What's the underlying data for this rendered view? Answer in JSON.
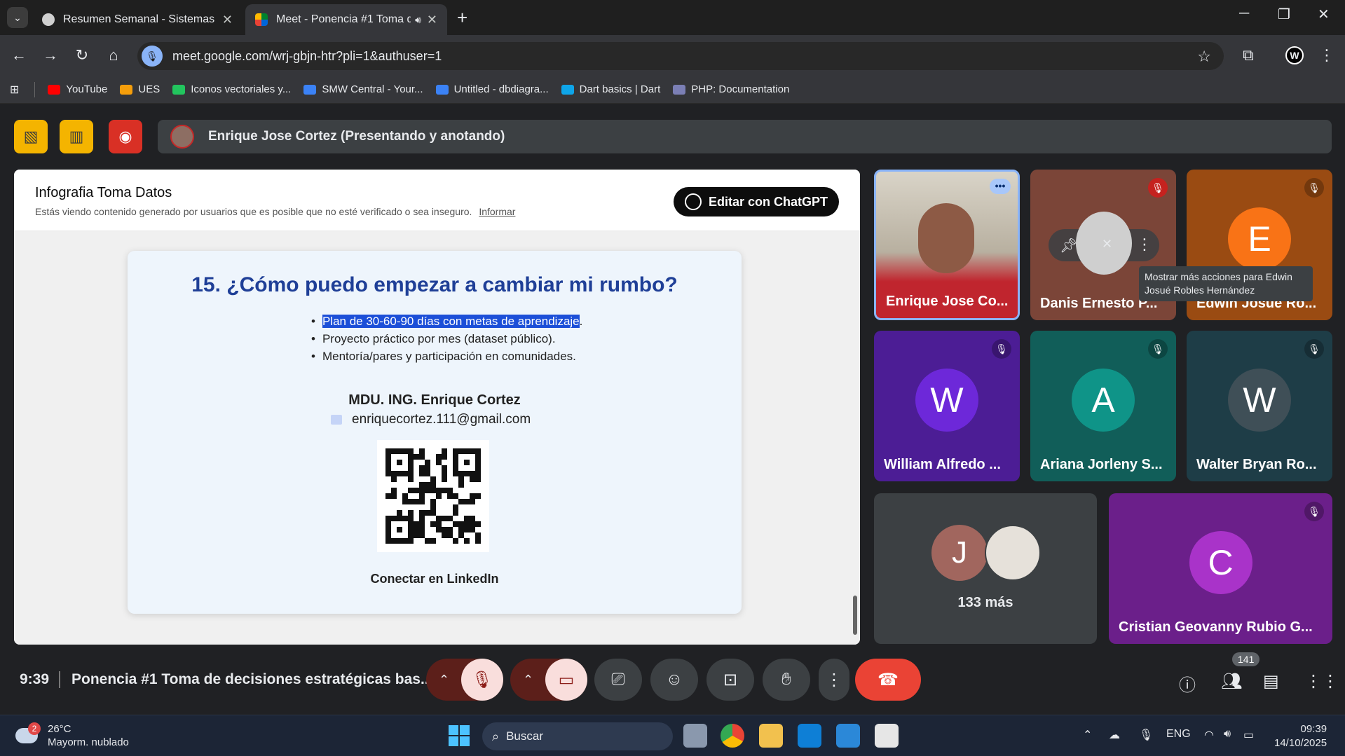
{
  "browser": {
    "tabs": [
      {
        "title": "Resumen Semanal - Sistemas",
        "active": false
      },
      {
        "title": "Meet - Ponencia #1 Toma d",
        "active": true
      }
    ],
    "url": "meet.google.com/wrj-gbjn-htr?pli=1&authuser=1",
    "bookmarks": [
      {
        "label": "YouTube",
        "color": "#ff0000"
      },
      {
        "label": "UES",
        "color": "#f59e0b"
      },
      {
        "label": "Iconos vectoriales y...",
        "color": "#22c55e"
      },
      {
        "label": "SMW Central - Your...",
        "color": "#3b82f6"
      },
      {
        "label": "Untitled - dbdiagra...",
        "color": "#3b82f6"
      },
      {
        "label": "Dart basics | Dart",
        "color": "#0ea5e9"
      },
      {
        "label": "PHP: Documentation",
        "color": "#7b7fb5"
      }
    ]
  },
  "presenter": {
    "text": "Enrique Jose Cortez (Presentando y anotando)"
  },
  "shared_content": {
    "title": "Infografia Toma Datos",
    "warning": "Estás viendo contenido generado por usuarios que es posible que no esté verificado o sea inseguro.",
    "report_link": "Informar",
    "edit_button": "Editar con ChatGPT",
    "slide": {
      "heading": "15. ¿Cómo puedo empezar a cambiar mi rumbo?",
      "bullets": [
        {
          "text": "Plan de 30-60-90 días con metas de aprendizaje",
          "suffix": "."
        },
        {
          "text": "Proyecto práctico por mes (dataset público).",
          "suffix": ""
        },
        {
          "text": "Mentoría/pares y participación en comunidades.",
          "suffix": ""
        }
      ],
      "name": "MDU. ING. Enrique Cortez",
      "email": "enriquecortez.111@gmail.com",
      "link": "Conectar en LinkedIn"
    }
  },
  "participants": [
    {
      "name": "Enrique Jose Co...",
      "initial": "",
      "color": "#c62828"
    },
    {
      "name": "Danis Ernesto P...",
      "initial": "",
      "color": "#8a4a3a"
    },
    {
      "name": "Edwin Josue Ro...",
      "initial": "E",
      "color": "#b45309"
    },
    {
      "name": "William Alfredo ...",
      "initial": "W",
      "color": "#5b21b6"
    },
    {
      "name": "Ariana Jorleny S...",
      "initial": "A",
      "color": "#0f766e"
    },
    {
      "name": "Walter Bryan Ro...",
      "initial": "W",
      "color": "#1f4a55"
    },
    {
      "name": "Cristian Geovanny Rubio G...",
      "initial": "C",
      "color": "#7e22ce"
    }
  ],
  "more_tile": {
    "initial": "J",
    "label": "133 más"
  },
  "tooltip": "Mostrar más acciones para Edwin Josué Robles Hernández",
  "controls": {
    "time": "9:39",
    "meeting_title": "Ponencia #1 Toma de decisiones estratégicas bas...",
    "participant_count": "141"
  },
  "taskbar": {
    "weather_temp": "26°C",
    "weather_desc": "Mayorm. nublado",
    "weather_badge": "2",
    "search_placeholder": "Buscar",
    "lang": "ENG",
    "time": "09:39",
    "date": "14/10/2025"
  }
}
